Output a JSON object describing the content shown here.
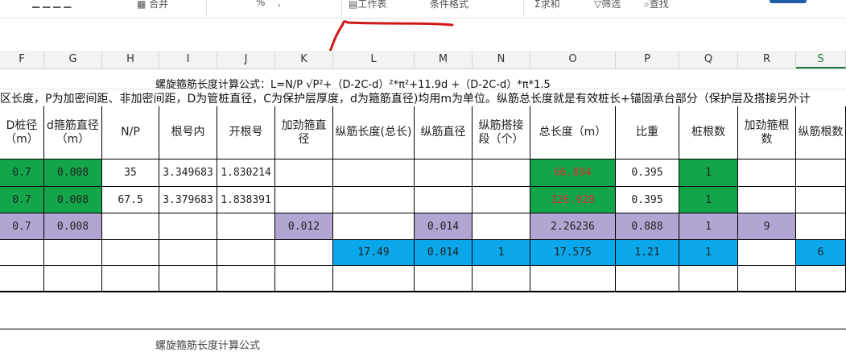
{
  "toolbar": {
    "items": [
      "合并",
      "%",
      ",",
      "工作表",
      "条件格式",
      "求和",
      "筛选",
      "查找"
    ]
  },
  "columns": [
    "F",
    "G",
    "H",
    "I",
    "J",
    "K",
    "L",
    "M",
    "N",
    "O",
    "P",
    "Q",
    "R",
    "S"
  ],
  "selected_column": "S",
  "formula_text": "螺旋箍筋长度计算公式：L=N/P √P²+（D-2C-d）²*π²+11.9d +（D-2C-d）*π*1.5",
  "description": "区长度，P为加密间距、非加密间距，D为管桩直径，C为保护层厚度，d为箍筋直径)均用m为单位。纵筋总长度就是有效桩长+锚固承台部分（保护层及搭接另外计",
  "table": {
    "headers": [
      "D桩径（m）",
      "d箍筋直径（m）",
      "N/P",
      "根号内",
      "开根号",
      "加劲箍直径",
      "纵筋长度(总长)",
      "纵筋直径",
      "纵筋搭接段（个）",
      "总长度（m）",
      "比重",
      "桩根数",
      "加劲箍根数",
      "纵筋根数"
    ],
    "rows": [
      [
        "0.7",
        "0.008",
        "35",
        "3.349683",
        "1.830214",
        "",
        "",
        "",
        "",
        "66.894",
        "0.395",
        "1",
        "",
        ""
      ],
      [
        "0.7",
        "0.008",
        "67.5",
        "3.379683",
        "1.838391",
        "",
        "",
        "",
        "",
        "126.928",
        "0.395",
        "1",
        "",
        ""
      ],
      [
        "0.7",
        "0.008",
        "",
        "",
        "",
        "0.012",
        "",
        "0.014",
        "",
        "2.26236",
        "0.888",
        "1",
        "9",
        ""
      ],
      [
        "",
        "",
        "",
        "",
        "",
        "",
        "17.49",
        "0.014",
        "1",
        "17.575",
        "1.21",
        "1",
        "",
        "6"
      ],
      [
        "",
        "",
        "",
        "",
        "",
        "",
        "",
        "",
        "",
        "",
        "",
        "",
        "",
        ""
      ]
    ]
  },
  "next_formula": "螺旋箍筋长度计算公式"
}
